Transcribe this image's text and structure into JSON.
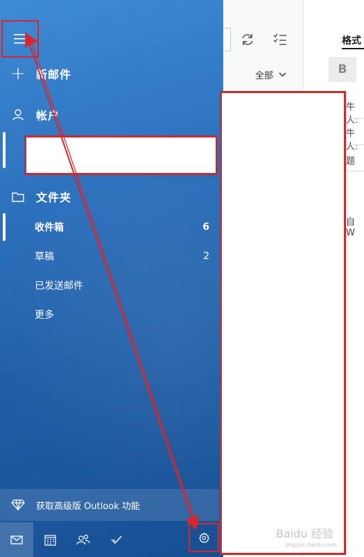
{
  "sidebar": {
    "new_mail": "新邮件",
    "account_header": "帐户",
    "folders_header": "文件夹",
    "folders": [
      {
        "label": "收件箱",
        "count": "6"
      },
      {
        "label": "草稿",
        "count": "2"
      },
      {
        "label": "已发送邮件",
        "count": ""
      },
      {
        "label": "更多",
        "count": ""
      }
    ],
    "upgrade": "获取高级版 Outlook 功能"
  },
  "list": {
    "filter": "全部"
  },
  "compose": {
    "format_tab": "格式",
    "bold": "B",
    "field1": "牛人:",
    "field2": "牛人:",
    "field3": "题",
    "body_snippet": "自 W"
  },
  "icons": {
    "menu": "hamburger-icon",
    "new_mail": "plus-icon",
    "account": "person-icon",
    "folder": "folder-icon",
    "upgrade": "diamond-icon",
    "mail": "mail-icon",
    "calendar": "calendar-icon",
    "people": "people-icon",
    "todo": "checkmark-icon",
    "settings": "gear-icon"
  },
  "colors": {
    "sidebar": "#2f74c0",
    "annotation": "#d9262a"
  },
  "watermark": {
    "brand": "Baidu 经验",
    "url": "jingyan.baidu.com"
  }
}
